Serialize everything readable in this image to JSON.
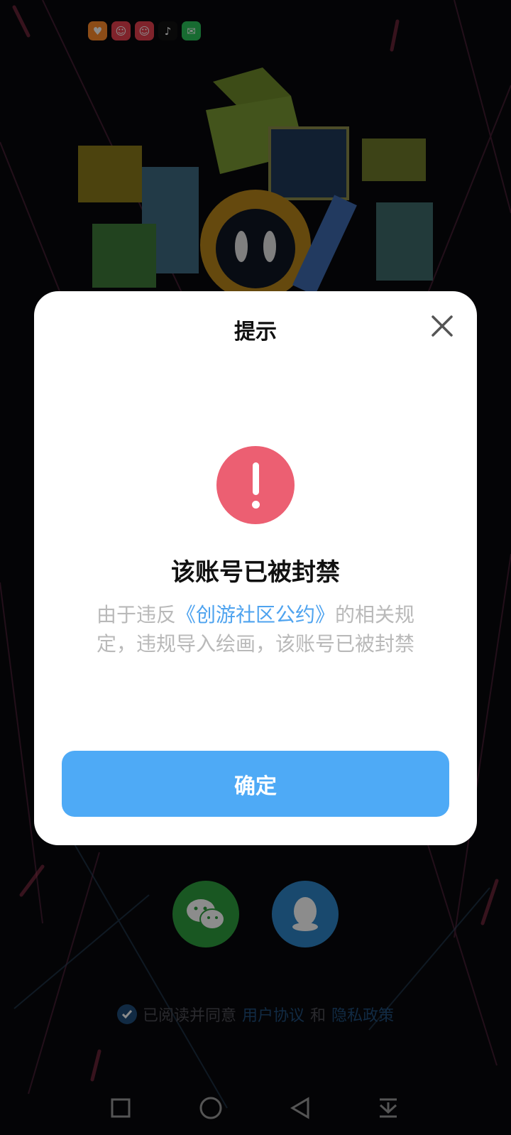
{
  "status_bar": {
    "notification_icons": [
      {
        "name": "heart-app-icon",
        "color": "#ff8a2a"
      },
      {
        "name": "clown-app-icon",
        "color": "#e8404f"
      },
      {
        "name": "clown-app-icon",
        "color": "#e8404f"
      },
      {
        "name": "tiktok-icon",
        "color": "#000000"
      },
      {
        "name": "wechat-icon",
        "color": "#2bc45a"
      }
    ]
  },
  "background": {
    "login_buttons": [
      {
        "name": "wechat-login-button",
        "icon": "wechat-icon",
        "color": "#2f9e3f"
      },
      {
        "name": "qq-login-button",
        "icon": "qq-penguin-icon",
        "color": "#2f86c8"
      }
    ],
    "agreement": {
      "prefix": "已阅读并同意",
      "user_agreement": "用户协议",
      "conjunction": "和",
      "privacy_policy": "隐私政策",
      "checked": true
    }
  },
  "dialog": {
    "title": "提示",
    "heading": "该账号已被封禁",
    "body_prefix": "由于违反",
    "body_link": "《创游社区公约》",
    "body_suffix": "的相关规定，违规导入绘画，该账号已被封禁",
    "confirm_label": "确定",
    "icon": "exclamation-icon",
    "accent_color": "#4eaaf6",
    "alert_color": "#ec5f72"
  },
  "nav_bar": {
    "buttons": [
      "recent-apps-icon",
      "home-icon",
      "back-icon",
      "notification-pulldown-icon"
    ]
  }
}
